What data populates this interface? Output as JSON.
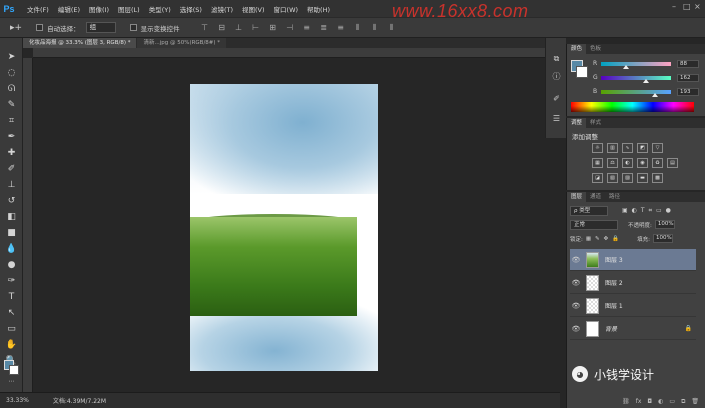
{
  "menu": {
    "logo": "Ps",
    "items": [
      "文件(F)",
      "编辑(E)",
      "图像(I)",
      "图层(L)",
      "类型(Y)",
      "选择(S)",
      "滤镜(T)",
      "视图(V)",
      "窗口(W)",
      "帮助(H)"
    ],
    "watermark": "www.16xx8.com"
  },
  "options": {
    "tool_icon": "move-tool-icon",
    "auto_select_label": "自动选择：",
    "auto_select_value": "组",
    "show_transform_label": "显示变换控件"
  },
  "tabs": [
    {
      "label": "化妆品海报 @ 33.3% (图层 3, RGB/8) *",
      "active": true
    },
    {
      "label": "清新...jpg @ 50%(RGB/8#) *",
      "active": false
    }
  ],
  "status": {
    "zoom": "33.33%",
    "doc_info": "文档:4.39M/7.22M"
  },
  "color_panel": {
    "tabs": [
      "颜色",
      "色板"
    ],
    "fg_color": "#5889a6",
    "bg_color": "#ffffff",
    "channels": [
      {
        "label": "R",
        "value": "88"
      },
      {
        "label": "G",
        "value": "162"
      },
      {
        "label": "B",
        "value": "193"
      }
    ]
  },
  "adjustments_panel": {
    "tabs": [
      "调整",
      "样式"
    ],
    "title": "添加调整"
  },
  "layers_panel": {
    "tabs": [
      "图层",
      "通道",
      "路径"
    ],
    "filter_label": "ρ 类型",
    "blend_mode": "正常",
    "opacity_label": "不透明度:",
    "opacity_value": "100%",
    "lock_label": "锁定:",
    "fill_label": "填充:",
    "fill_value": "100%",
    "layers": [
      {
        "name": "图层 3",
        "selected": true
      },
      {
        "name": "图层 2",
        "selected": false
      },
      {
        "name": "图层 1",
        "selected": false
      },
      {
        "name": "背景",
        "selected": false
      }
    ]
  },
  "wechat": {
    "text": "小钱学设计"
  }
}
